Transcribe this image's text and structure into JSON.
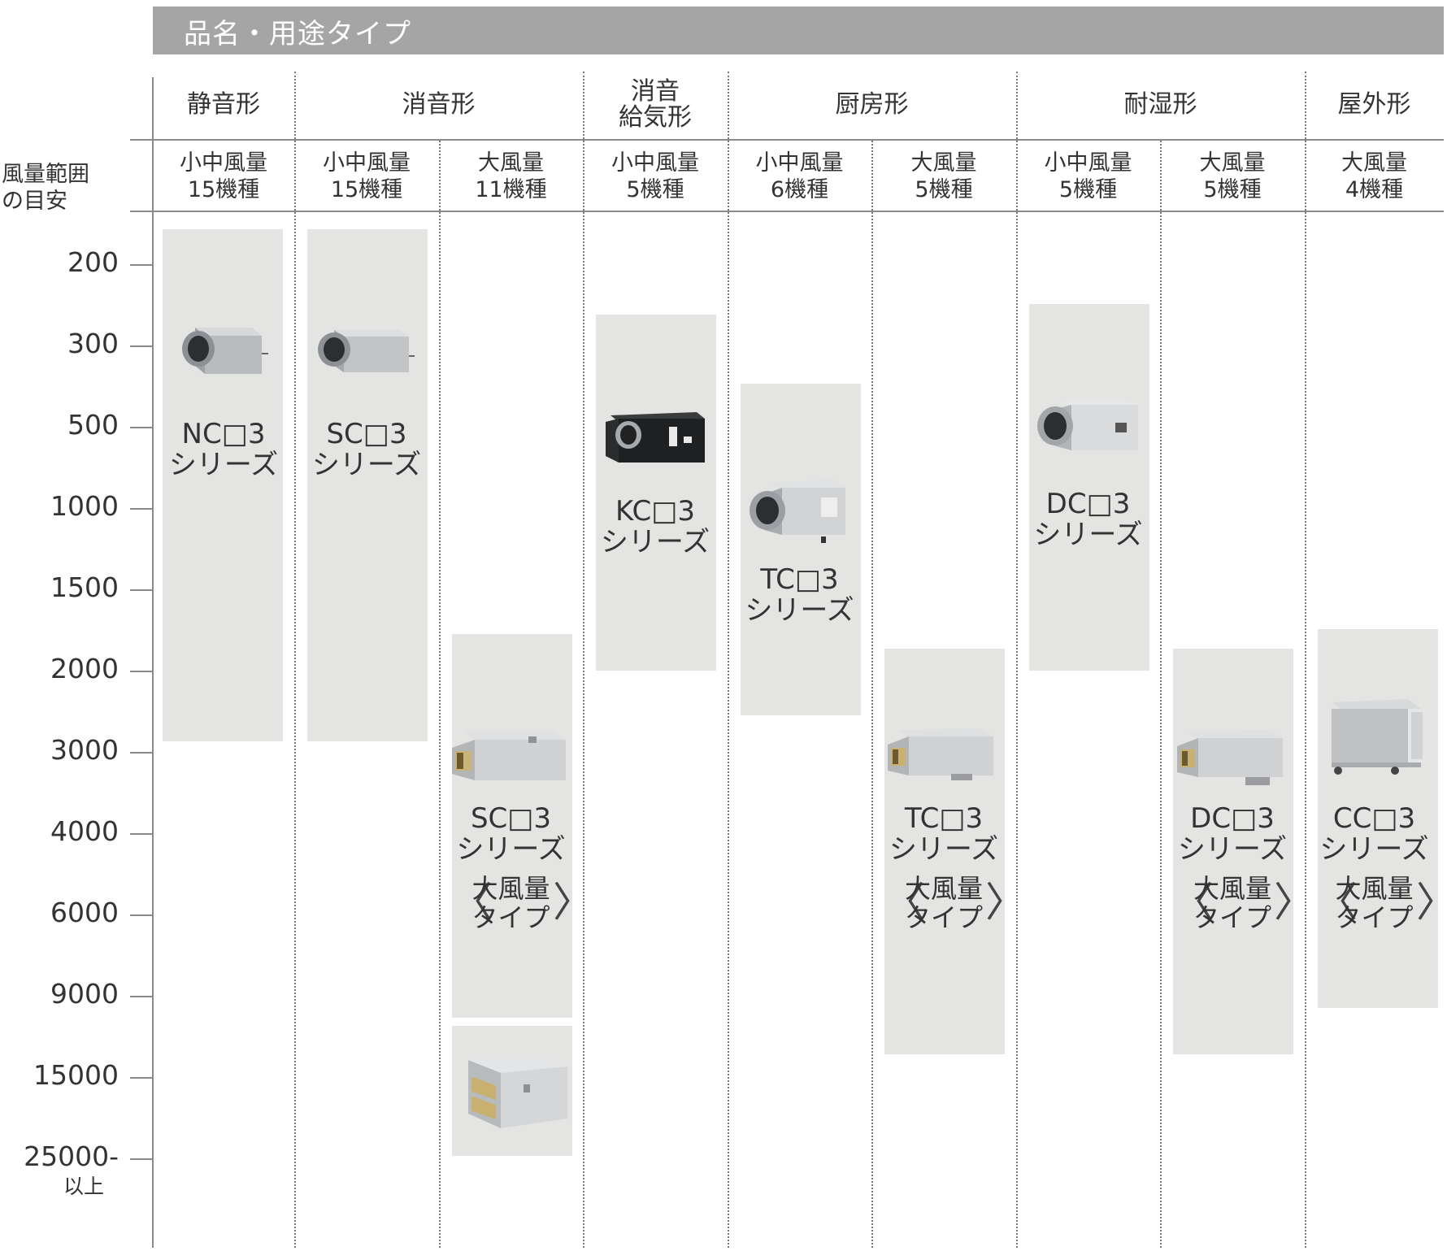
{
  "header": {
    "title": "品名・用途タイプ"
  },
  "y_axis": {
    "title_line1": "風量範囲",
    "title_line2": "の目安",
    "ticks": [
      "200",
      "300",
      "500",
      "1000",
      "1500",
      "2000",
      "3000",
      "4000",
      "6000",
      "9000",
      "15000",
      "25000-"
    ],
    "last_tick_suffix": "以上"
  },
  "categories": [
    {
      "label": "静音形"
    },
    {
      "label": "消音形"
    },
    {
      "label_line1": "消音",
      "label_line2": "給気形"
    },
    {
      "label": "厨房形"
    },
    {
      "label": "耐湿形"
    },
    {
      "label": "屋外形"
    }
  ],
  "subcolumns": [
    {
      "line1": "小中風量",
      "line2": "15機種"
    },
    {
      "line1": "小中風量",
      "line2": "15機種"
    },
    {
      "line1": "大風量",
      "line2": "11機種"
    },
    {
      "line1": "小中風量",
      "line2": "5機種"
    },
    {
      "line1": "小中風量",
      "line2": "6機種"
    },
    {
      "line1": "大風量",
      "line2": "5機種"
    },
    {
      "line1": "小中風量",
      "line2": "5機種"
    },
    {
      "line1": "大風量",
      "line2": "5機種"
    },
    {
      "line1": "大風量",
      "line2": "4機種"
    }
  ],
  "series": [
    {
      "name": "NC□3",
      "suffix": "シリーズ",
      "icon": "cabinet-fan-icon"
    },
    {
      "name": "SC□3",
      "suffix": "シリーズ",
      "icon": "cabinet-fan-icon"
    },
    {
      "name": "SC□3",
      "suffix": "シリーズ",
      "type_line1": "大風量",
      "type_line2": "タイプ",
      "icon": "large-cabinet-fan-icon"
    },
    {
      "name": "KC□3",
      "suffix": "シリーズ",
      "icon": "black-cabinet-fan-icon"
    },
    {
      "name": "TC□3",
      "suffix": "シリーズ",
      "icon": "cabinet-fan-icon"
    },
    {
      "name": "TC□3",
      "suffix": "シリーズ",
      "type_line1": "大風量",
      "type_line2": "タイプ",
      "icon": "large-cabinet-fan-icon"
    },
    {
      "name": "DC□3",
      "suffix": "シリーズ",
      "icon": "cabinet-fan-icon"
    },
    {
      "name": "DC□3",
      "suffix": "シリーズ",
      "type_line1": "大風量",
      "type_line2": "タイプ",
      "icon": "large-cabinet-fan-icon"
    },
    {
      "name": "CC□3",
      "suffix": "シリーズ",
      "type_line1": "大風量",
      "type_line2": "タイプ",
      "icon": "outdoor-cabinet-fan-icon"
    }
  ],
  "colors": {
    "header_bg": "#a4a5a4",
    "band": "#e4e4e3",
    "line": "#8a8a8a",
    "text": "#333333"
  }
}
